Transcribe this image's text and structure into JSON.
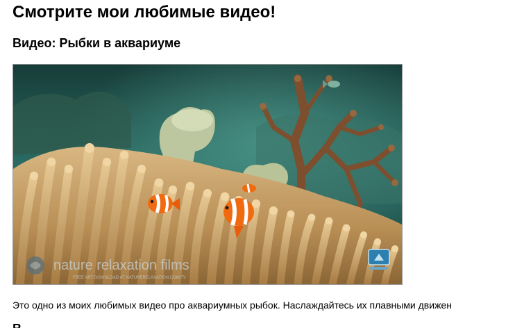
{
  "page": {
    "title": "Смотрите мои любимые видео!"
  },
  "video": {
    "title": "Видео: Рыбки в аквариуме",
    "watermark_text": "nature relaxation films",
    "watermark_subtext": "FREE ART DOWNLOAD AT NATURERELAXATION.COM/TV",
    "corner_logo": "tv-logo",
    "description": "Это одно из моих любимых видео про аквариумных рыбок. Наслаждайтесь их плавными движен"
  },
  "next_section": {
    "heading_fragment": "В"
  },
  "colors": {
    "water": "#1d4a45",
    "anemone": "#c9a36a",
    "clownfish": "#f06a10",
    "coral": "#7a4a2e"
  }
}
